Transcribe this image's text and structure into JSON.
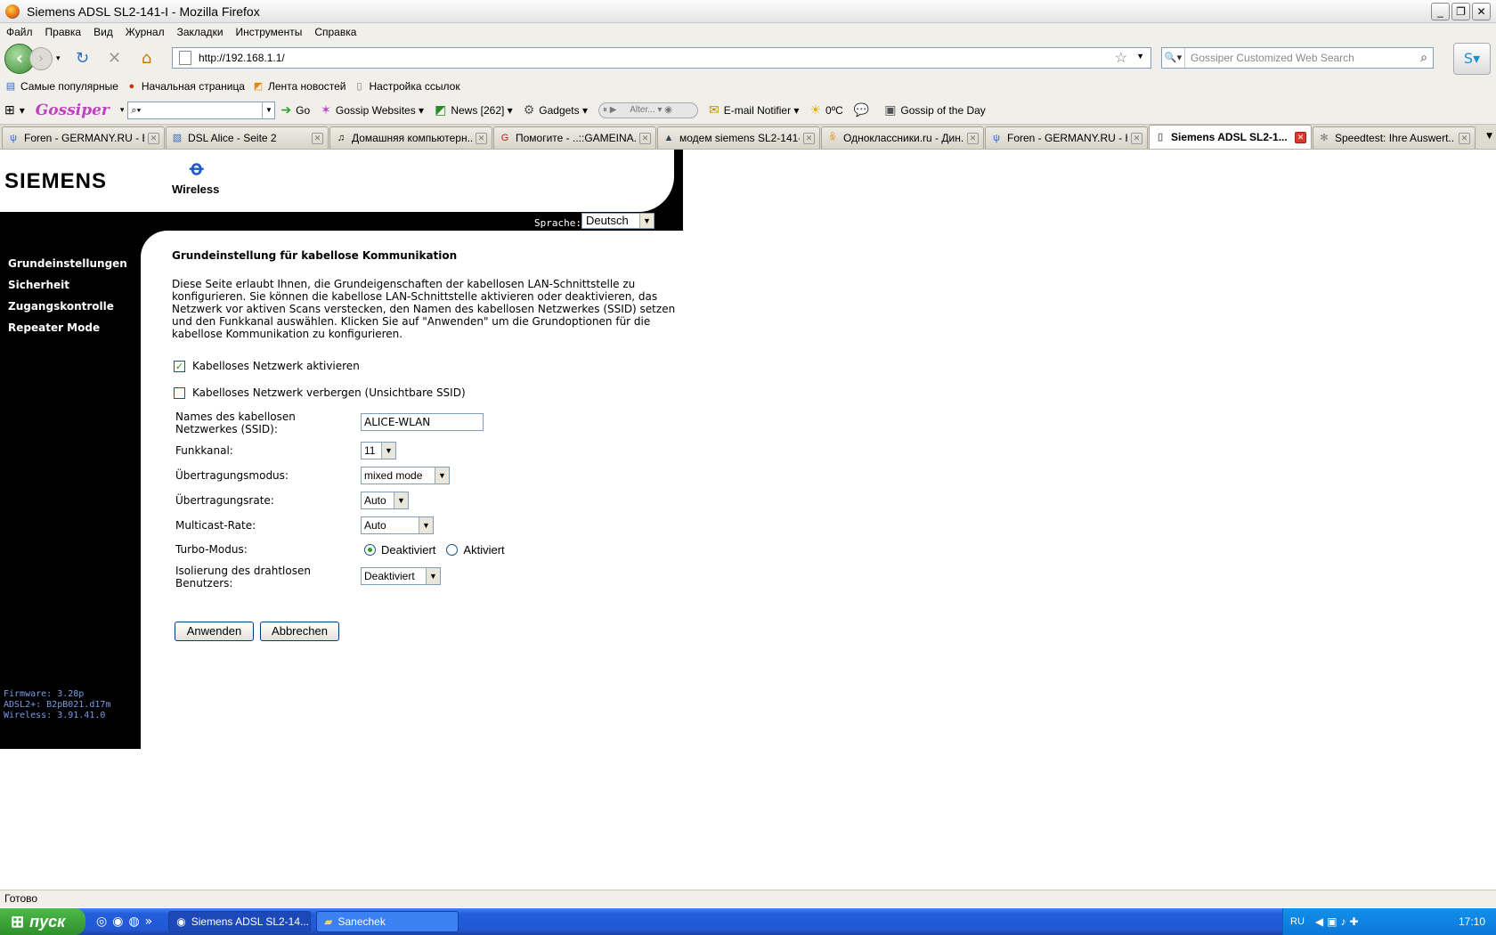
{
  "window": {
    "title": "Siemens ADSL SL2-141-I - Mozilla Firefox",
    "controls": [
      "_",
      "❐",
      "✕"
    ]
  },
  "menu": [
    "Файл",
    "Правка",
    "Вид",
    "Журнал",
    "Закладки",
    "Инструменты",
    "Справка"
  ],
  "nav": {
    "url": "http://192.168.1.1/",
    "search_placeholder": "Gossiper Customized Web Search"
  },
  "bookmarks": [
    "Самые популярные",
    "Начальная страница",
    "Лента новостей",
    "Настройка ссылок"
  ],
  "gossip_toolbar": {
    "brand": "Gossiper",
    "go": "Go",
    "websites": "Gossip Websites",
    "news": "News [262]",
    "gadgets": "Gadgets",
    "player_text": "Alter...",
    "email": "E-mail Notifier",
    "weather": "0ºC",
    "gotd": "Gossip of the Day"
  },
  "tabs": [
    {
      "label": "Foren - GERMANY.RU - B...",
      "active": false
    },
    {
      "label": "DSL Alice - Seite 2",
      "active": false
    },
    {
      "label": "Домашняя компьютерн...",
      "active": false
    },
    {
      "label": "Помогите - ..::GAMEINA...",
      "active": false
    },
    {
      "label": "модем siemens SL2-141-I...",
      "active": false
    },
    {
      "label": "Одноклассники.ru - Дин...",
      "active": false
    },
    {
      "label": "Foren - GERMANY.RU - H...",
      "active": false
    },
    {
      "label": "Siemens ADSL SL2-1...",
      "active": true
    },
    {
      "label": "Speedtest: Ihre Auswert...",
      "active": false
    }
  ],
  "router": {
    "brand": "SIEMENS",
    "section": "Wireless",
    "language_label": "Sprache:",
    "language_value": "Deutsch",
    "sidebar": [
      "Grundeinstellungen",
      "Sicherheit",
      "Zugangskontrolle",
      "Repeater Mode"
    ],
    "firmware": [
      "Firmware: 3.28p",
      "ADSL2+: B2pB021.d17m",
      "Wireless: 3.91.41.0"
    ],
    "heading": "Grundeinstellung für kabellose Kommunikation",
    "description": "Diese Seite erlaubt Ihnen, die Grundeigenschaften der kabellosen LAN-Schnittstelle zu konfigurieren. Sie können die kabellose LAN-Schnittstelle aktivieren oder deaktivieren, das Netzwerk vor aktiven Scans verstecken, den Namen des kabellosen Netzwerkes (SSID) setzen und den Funkkanal auswählen. Klicken Sie auf \"Anwenden\" um die Grundoptionen für die kabellose Kommunikation zu konfigurieren.",
    "enable_wlan": {
      "label": "Kabelloses Netzwerk aktivieren",
      "checked": true
    },
    "hide_ssid": {
      "label": "Kabelloses Netzwerk verbergen (Unsichtbare SSID)",
      "checked": false
    },
    "ssid": {
      "label": "Names des kabellosen Netzwerkes (SSID):",
      "value": "ALICE-WLAN"
    },
    "channel": {
      "label": "Funkkanal:",
      "value": "11"
    },
    "mode": {
      "label": "Übertragungsmodus:",
      "value": "mixed mode"
    },
    "rate": {
      "label": "Übertragungsrate:",
      "value": "Auto"
    },
    "multicast": {
      "label": "Multicast-Rate:",
      "value": "Auto"
    },
    "turbo": {
      "label": "Turbo-Modus:",
      "off": "Deaktiviert",
      "on": "Aktiviert",
      "selected": "Deaktiviert"
    },
    "isolation": {
      "label": "Isolierung des drahtlosen Benutzers:",
      "value": "Deaktiviert"
    },
    "apply": "Anwenden",
    "cancel": "Abbrechen"
  },
  "status": "Готово",
  "taskbar": {
    "start": "пуск",
    "tasks": [
      "Siemens ADSL SL2-14...",
      "Sanechek"
    ],
    "lang": "RU",
    "time": "17:10"
  }
}
